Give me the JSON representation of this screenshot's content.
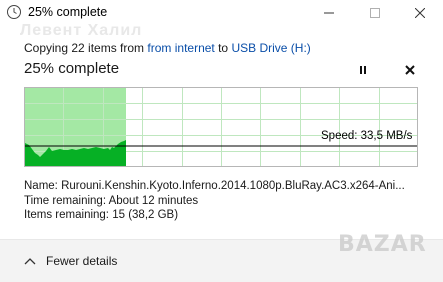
{
  "window": {
    "title": "25% complete",
    "icon": "clock-icon"
  },
  "watermark_top": "Левент Халил",
  "copy_line": {
    "prefix": "Copying 22 items from ",
    "source": "from internet",
    "middle": " to ",
    "destination": "USB Drive (H:)"
  },
  "progress": {
    "heading": "25% complete",
    "fraction": 0.25
  },
  "graph": {
    "speed_label": "Speed: 33,5 MB/s",
    "colors": {
      "fill": "#06b025",
      "fill_light": "#a4e8a4",
      "grid": "#bfe7bf",
      "border": "#b6b6b6",
      "line": "#000000"
    }
  },
  "details": {
    "name_label": "Name:",
    "name_value": "Rurouni.Kenshin.Kyoto.Inferno.2014.1080p.BluRay.AC3.x264-Ani...",
    "time_label": "Time remaining:",
    "time_value": "About 12 minutes",
    "items_label": "Items remaining:",
    "items_value": "15 (38,2 GB)"
  },
  "footer": {
    "fewer_details": "Fewer details"
  },
  "watermark": "BAZAR"
}
